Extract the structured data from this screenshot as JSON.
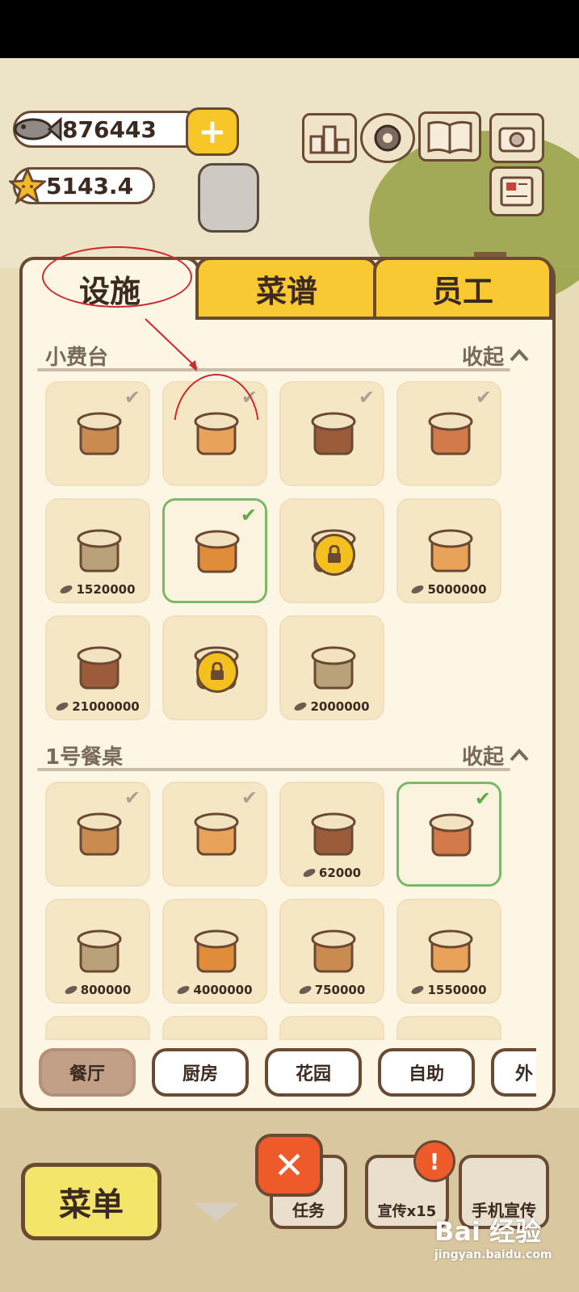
{
  "hud": {
    "fish_currency": "876443",
    "star_rating": "5143.4"
  },
  "tabs": [
    {
      "label": "设施"
    },
    {
      "label": "菜谱"
    },
    {
      "label": "员工"
    }
  ],
  "sections": [
    {
      "title": "小费台",
      "collapse_label": "收起",
      "items": [
        {
          "owned": true,
          "price": ""
        },
        {
          "owned": true,
          "price": ""
        },
        {
          "owned": true,
          "price": ""
        },
        {
          "owned": true,
          "price": ""
        },
        {
          "owned": false,
          "price": "1520000"
        },
        {
          "owned": true,
          "selected": true,
          "price": ""
        },
        {
          "locked": true,
          "price": ""
        },
        {
          "owned": false,
          "price": "5000000"
        },
        {
          "owned": false,
          "price": "21000000"
        },
        {
          "locked": true,
          "price": ""
        },
        {
          "owned": false,
          "price": "2000000"
        }
      ]
    },
    {
      "title": "1号餐桌",
      "collapse_label": "收起",
      "items": [
        {
          "owned": true,
          "price": ""
        },
        {
          "owned": true,
          "price": ""
        },
        {
          "owned": false,
          "price": "62000"
        },
        {
          "owned": true,
          "selected": true,
          "price": ""
        },
        {
          "owned": false,
          "price": "800000"
        },
        {
          "owned": false,
          "price": "4000000"
        },
        {
          "owned": false,
          "price": "750000"
        },
        {
          "owned": false,
          "price": "1550000"
        }
      ]
    }
  ],
  "category_tabs": [
    {
      "label": "餐厅",
      "active": true
    },
    {
      "label": "厨房"
    },
    {
      "label": "花园"
    },
    {
      "label": "自助"
    },
    {
      "label": "外"
    }
  ],
  "bottom_bar": {
    "menu_label": "菜单",
    "tasks_label": "任务",
    "promo_label": "宣传x15",
    "phone_promo_label": "手机宣传",
    "close_symbol": "✕",
    "alert_symbol": "!"
  },
  "watermark": {
    "brand": "Bai 经验",
    "url": "jingyan.baidu.com"
  },
  "colors": {
    "brown_border": "#6b4a34",
    "tab_yellow": "#f9c933",
    "owned_check": "#a9a196",
    "selected_green": "#7ab86a",
    "annotation_red": "#d0282c"
  },
  "icons": [
    "fish-icon",
    "star-icon",
    "plus-icon",
    "leaderboard-icon",
    "settings-gear-icon",
    "book-icon",
    "camera-icon",
    "newspaper-icon",
    "check-icon",
    "lock-icon",
    "chevron-up-icon",
    "close-icon",
    "exclamation-icon"
  ]
}
